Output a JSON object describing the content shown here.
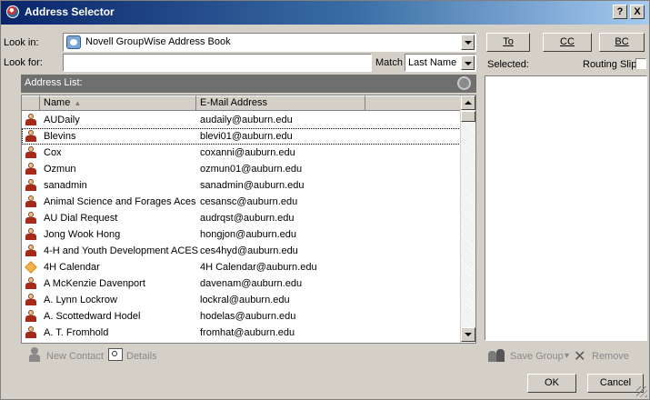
{
  "window": {
    "title": "Address Selector",
    "help_btn": "?",
    "close_btn": "X"
  },
  "lookin": {
    "label": "Look in:",
    "value": "Novell GroupWise Address Book"
  },
  "lookfor": {
    "label": "Look for:",
    "value": "",
    "match_label": "Match",
    "match_value": "Last Name"
  },
  "address_list": {
    "header": "Address List:",
    "columns": [
      "Name",
      "E-Mail Address"
    ],
    "rows": [
      {
        "name": "AUDaily",
        "email": "audaily@auburn.edu",
        "icon": "person-icon"
      },
      {
        "name": "Blevins",
        "email": "blevi01@auburn.edu",
        "icon": "person-icon"
      },
      {
        "name": "Cox",
        "email": "coxanni@auburn.edu",
        "icon": "person-icon"
      },
      {
        "name": "Ozmun",
        "email": "ozmun01@auburn.edu",
        "icon": "person-icon"
      },
      {
        "name": "sanadmin",
        "email": "sanadmin@auburn.edu",
        "icon": "person-icon"
      },
      {
        "name": "Animal Science and Forages Aces",
        "email": "cesansc@auburn.edu",
        "icon": "person-icon"
      },
      {
        "name": "AU Dial Request",
        "email": "audrqst@auburn.edu",
        "icon": "person-icon"
      },
      {
        "name": "Jong Wook Hong",
        "email": "hongjon@auburn.edu",
        "icon": "person-icon"
      },
      {
        "name": "4-H and Youth Development ACES",
        "email": "ces4hyd@auburn.edu",
        "icon": "person-icon"
      },
      {
        "name": "4H Calendar",
        "email": "4H Calendar@auburn.edu",
        "icon": "calendar-icon"
      },
      {
        "name": "A McKenzie Davenport",
        "email": "davenam@auburn.edu",
        "icon": "person-icon"
      },
      {
        "name": "A. Lynn Lockrow",
        "email": "lockral@auburn.edu",
        "icon": "person-icon"
      },
      {
        "name": "A. Scottedward Hodel",
        "email": "hodelas@auburn.edu",
        "icon": "person-icon"
      },
      {
        "name": "A. T. Fromhold",
        "email": "fromhat@auburn.edu",
        "icon": "person-icon"
      }
    ]
  },
  "actions": {
    "new_contact": "New Contact",
    "details": "Details",
    "save_group": "Save Group",
    "remove": "Remove"
  },
  "recipients": {
    "to": "To",
    "cc": "CC",
    "bc": "BC",
    "selected_label": "Selected:",
    "routing_slip": "Routing Slip"
  },
  "footer": {
    "ok": "OK",
    "cancel": "Cancel"
  }
}
